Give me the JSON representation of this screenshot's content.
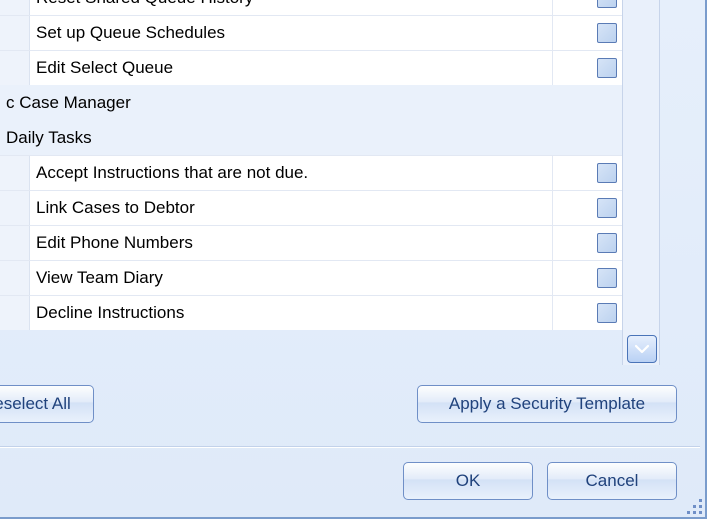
{
  "rows": [
    {
      "type": "leaf",
      "label": "Reset Shared Queue History"
    },
    {
      "type": "leaf",
      "label": "Set up Queue Schedules"
    },
    {
      "type": "leaf",
      "label": "Edit Select Queue"
    },
    {
      "type": "header",
      "label": "c Case Manager"
    },
    {
      "type": "header",
      "label": "Daily Tasks"
    },
    {
      "type": "leaf",
      "label": "Accept Instructions that are not due."
    },
    {
      "type": "leaf",
      "label": "Link Cases to Debtor"
    },
    {
      "type": "leaf",
      "label": "Edit Phone Numbers"
    },
    {
      "type": "leaf",
      "label": "View Team Diary"
    },
    {
      "type": "leaf",
      "label": "Decline Instructions"
    }
  ],
  "buttons": {
    "deselect_all": "Deselect All",
    "apply_template": "Apply a Security Template",
    "ok": "OK",
    "cancel": "Cancel"
  }
}
